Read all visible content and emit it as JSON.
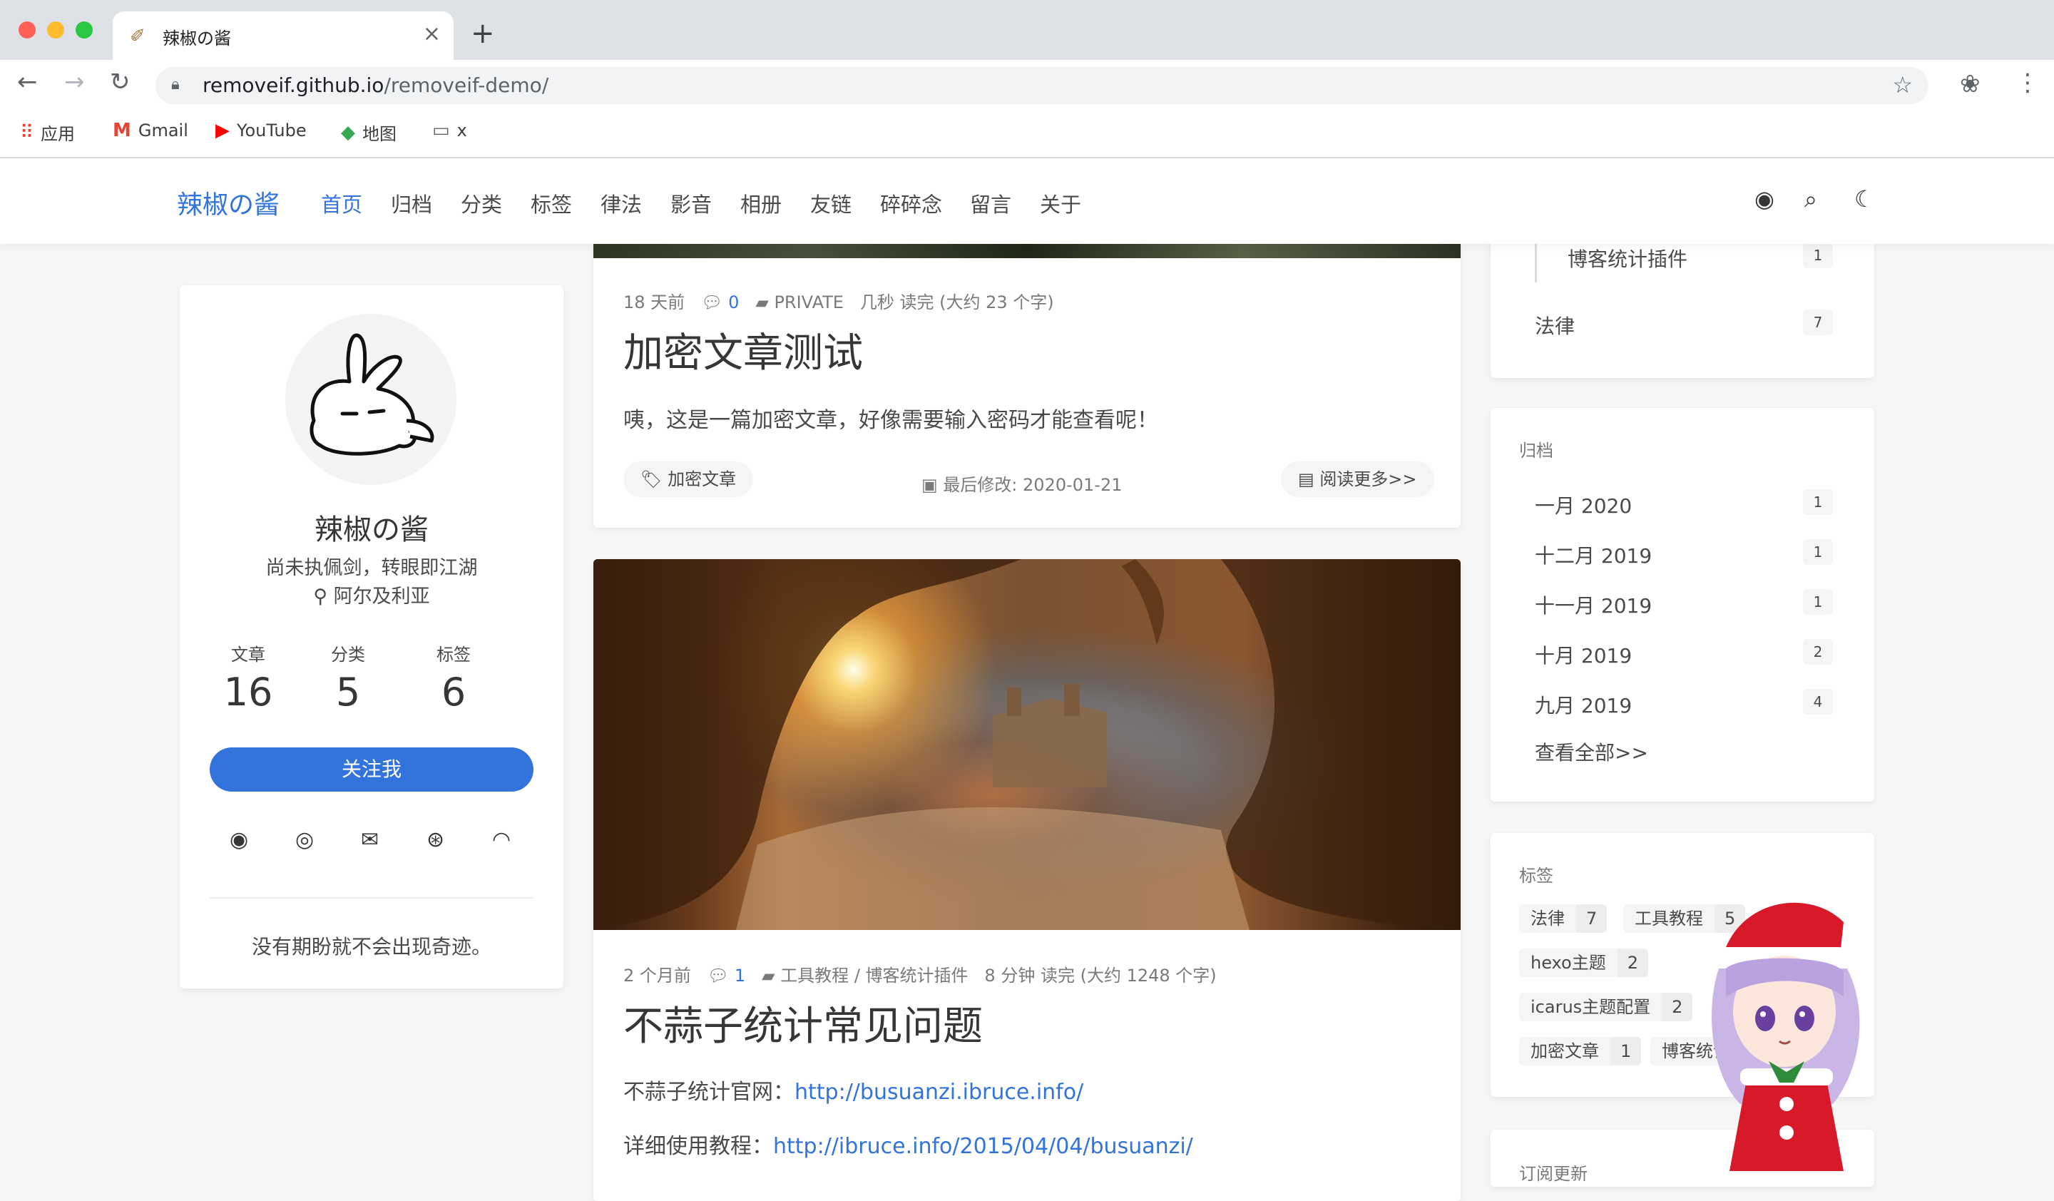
{
  "browser": {
    "tab_title": "辣椒の酱",
    "url_host": "removeif.github.io",
    "url_path": "/removeif-demo/",
    "bookmarks": [
      "应用",
      "Gmail",
      "YouTube",
      "地图",
      "x"
    ]
  },
  "site": {
    "brand": "辣椒の酱",
    "nav": [
      "首页",
      "归档",
      "分类",
      "标签",
      "律法",
      "影音",
      "相册",
      "友链",
      "碎碎念",
      "留言",
      "关于"
    ]
  },
  "profile": {
    "name": "辣椒の酱",
    "motto": "尚未执佩剑，转眼即江湖",
    "location": "阿尔及利亚",
    "stats": [
      {
        "label": "文章",
        "value": "16"
      },
      {
        "label": "分类",
        "value": "5"
      },
      {
        "label": "标签",
        "value": "6"
      }
    ],
    "follow_label": "关注我",
    "quote": "没有期盼就不会出现奇迹。"
  },
  "posts": [
    {
      "time": "18 天前",
      "comments": "0",
      "category": "PRIVATE",
      "read": "几秒 读完 (大约 23 个字)",
      "title": "加密文章测试",
      "excerpt": "咦，这是一篇加密文章，好像需要输入密码才能查看呢！",
      "tag": "加密文章",
      "modified": "最后修改: 2020-01-21",
      "read_more": "阅读更多>>"
    },
    {
      "time": "2 个月前",
      "comments": "1",
      "category": "工具教程 / 博客统计插件",
      "read": "8 分钟 读完 (大约 1248 个字)",
      "title": "不蒜子统计常见问题",
      "line1_label": "不蒜子统计官网：",
      "line1_link": "http://busuanzi.ibruce.info/",
      "line2_label": "详细使用教程：",
      "line2_link": "http://ibruce.info/2015/04/04/busuanzi/"
    }
  ],
  "categories": [
    {
      "name": "博客统计插件",
      "count": "1"
    },
    {
      "name": "法律",
      "count": "7"
    }
  ],
  "archive": {
    "heading": "归档",
    "items": [
      {
        "name": "一月 2020",
        "count": "1"
      },
      {
        "name": "十二月 2019",
        "count": "1"
      },
      {
        "name": "十一月 2019",
        "count": "1"
      },
      {
        "name": "十月 2019",
        "count": "2"
      },
      {
        "name": "九月 2019",
        "count": "4"
      }
    ],
    "view_all": "查看全部>>"
  },
  "tags": {
    "heading": "标签",
    "items": [
      {
        "name": "法律",
        "count": "7"
      },
      {
        "name": "工具教程",
        "count": "5"
      },
      {
        "name": "hexo主题",
        "count": "2"
      },
      {
        "name": "icarus主题配置",
        "count": "2"
      },
      {
        "name": "加密文章",
        "count": "1"
      },
      {
        "name": "博客统计",
        "count": ""
      }
    ]
  },
  "subscribe": {
    "heading": "订阅更新"
  }
}
